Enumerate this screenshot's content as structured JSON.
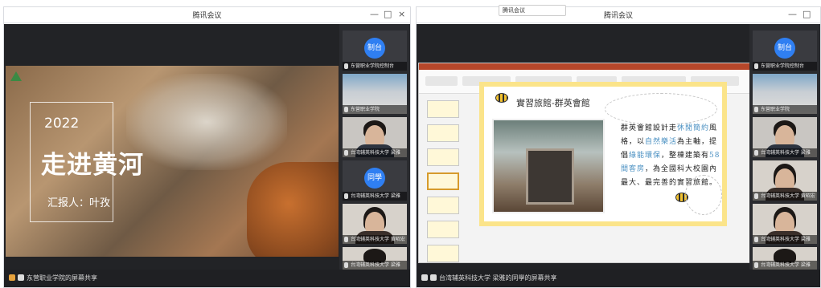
{
  "left_window": {
    "title": "腾讯会议",
    "slide": {
      "year": "2022",
      "heading": "走进黄河",
      "reporter": "汇报人：叶孜"
    },
    "participants": [
      {
        "badge": "制台",
        "caption": "东营职业学院控制台"
      },
      {
        "caption": "东营职业学院"
      },
      {
        "caption": "台湾辅英科技大学 梁雅"
      },
      {
        "badge": "同學",
        "caption": "台湾辅英科技大学 梁雅"
      },
      {
        "caption": "台湾辅英科技大学 黄昭宏"
      },
      {
        "caption": "台湾辅英科技大学 梁雅"
      }
    ],
    "share_label": "东营职业学院的屏幕共享"
  },
  "right_window": {
    "title": "腾讯会议",
    "tooltip": "腾讯会议",
    "slide": {
      "title": "實習旅館-群英會館",
      "body_parts": [
        {
          "t": "群英會館設計走",
          "hl": false
        },
        {
          "t": "休閒簡約",
          "hl": true
        },
        {
          "t": "風格，以",
          "hl": false
        },
        {
          "t": "自然樂活",
          "hl": true
        },
        {
          "t": "為主軸，提倡",
          "hl": false
        },
        {
          "t": "綠能環保",
          "hl": true
        },
        {
          "t": "，整棟建築有",
          "hl": false
        },
        {
          "t": "58間客房",
          "hl": true
        },
        {
          "t": "，為全國科大校園內最大、最完善的實習旅館。",
          "hl": false
        }
      ]
    },
    "participants": [
      {
        "badge": "制台",
        "caption": "东营职业学院控制台"
      },
      {
        "caption": "东营职业学院"
      },
      {
        "caption": "台湾辅英科技大学 梁雅"
      },
      {
        "caption": "台湾辅英科技大学 黄昭宏"
      },
      {
        "caption": "台湾辅英科技大学 梁雅"
      },
      {
        "caption": "台湾辅英科技大学 梁雅"
      }
    ],
    "share_label": "台湾辅英科技大学 梁雅的同學的屏幕共享"
  },
  "window_controls": {
    "minimize": "—",
    "maximize": "□",
    "close": "×"
  },
  "colors": {
    "accent": "#2f7ff2",
    "slide_border": "#fbe48a",
    "highlight": "#4a90c2"
  }
}
